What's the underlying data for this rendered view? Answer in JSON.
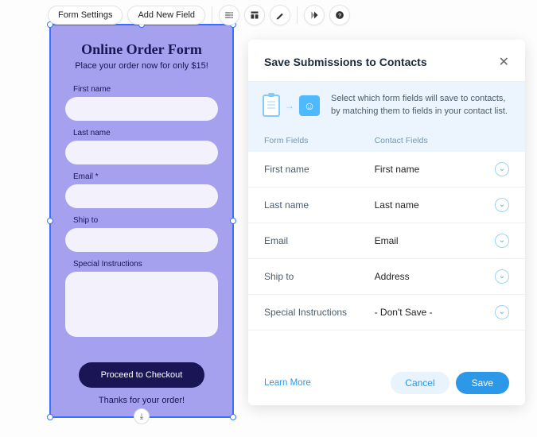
{
  "toolbar": {
    "form_settings": "Form Settings",
    "add_new_field": "Add New Field"
  },
  "form": {
    "title": "Online Order Form",
    "subtitle": "Place your order now for only $15!",
    "fields": {
      "first_name_label": "First name",
      "last_name_label": "Last name",
      "email_label": "Email *",
      "ship_to_label": "Ship to",
      "special_label": "Special Instructions"
    },
    "checkout_label": "Proceed to Checkout",
    "thanks": "Thanks for your order!"
  },
  "panel": {
    "title": "Save Submissions to Contacts",
    "banner_text": "Select which form fields will save to contacts, by matching them to fields in your contact list.",
    "col_form_fields": "Form Fields",
    "col_contact_fields": "Contact Fields",
    "rows": [
      {
        "form": "First name",
        "contact": "First name"
      },
      {
        "form": "Last name",
        "contact": "Last name"
      },
      {
        "form": "Email",
        "contact": "Email"
      },
      {
        "form": "Ship to",
        "contact": "Address"
      },
      {
        "form": "Special Instructions",
        "contact": "- Don't Save -"
      }
    ],
    "learn_more": "Learn More",
    "cancel": "Cancel",
    "save": "Save"
  }
}
